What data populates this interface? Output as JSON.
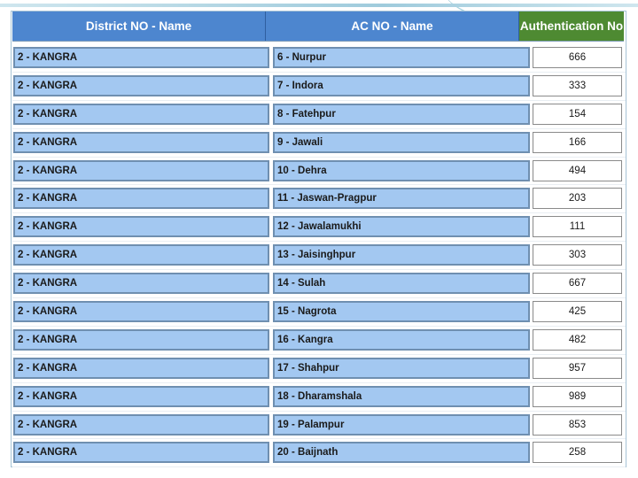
{
  "table": {
    "headers": {
      "district": "District NO - Name",
      "ac": "AC NO - Name",
      "auth": "Authentication No"
    },
    "colors": {
      "header_blue": "#4d86cf",
      "header_green": "#4e8a32",
      "cell_blue": "#a3c8f1"
    },
    "rows": [
      {
        "district": "2 - KANGRA",
        "ac": "6 - Nurpur",
        "auth": "666"
      },
      {
        "district": "2 - KANGRA",
        "ac": "7 - Indora",
        "auth": "333"
      },
      {
        "district": "2 - KANGRA",
        "ac": "8 - Fatehpur",
        "auth": "154"
      },
      {
        "district": "2 - KANGRA",
        "ac": "9 - Jawali",
        "auth": "166"
      },
      {
        "district": "2 - KANGRA",
        "ac": "10 - Dehra",
        "auth": "494"
      },
      {
        "district": "2 - KANGRA",
        "ac": "11 - Jaswan-Pragpur",
        "auth": "203"
      },
      {
        "district": "2 - KANGRA",
        "ac": "12 - Jawalamukhi",
        "auth": "111"
      },
      {
        "district": "2 - KANGRA",
        "ac": "13 - Jaisinghpur",
        "auth": "303"
      },
      {
        "district": "2 - KANGRA",
        "ac": "14 - Sulah",
        "auth": "667"
      },
      {
        "district": "2 - KANGRA",
        "ac": "15 - Nagrota",
        "auth": "425"
      },
      {
        "district": "2 - KANGRA",
        "ac": "16 - Kangra",
        "auth": "482"
      },
      {
        "district": "2 - KANGRA",
        "ac": "17 - Shahpur",
        "auth": "957"
      },
      {
        "district": "2 - KANGRA",
        "ac": "18 - Dharamshala",
        "auth": "989"
      },
      {
        "district": "2 - KANGRA",
        "ac": "19 - Palampur",
        "auth": "853"
      },
      {
        "district": "2 - KANGRA",
        "ac": "20 - Baijnath",
        "auth": "258"
      }
    ]
  }
}
